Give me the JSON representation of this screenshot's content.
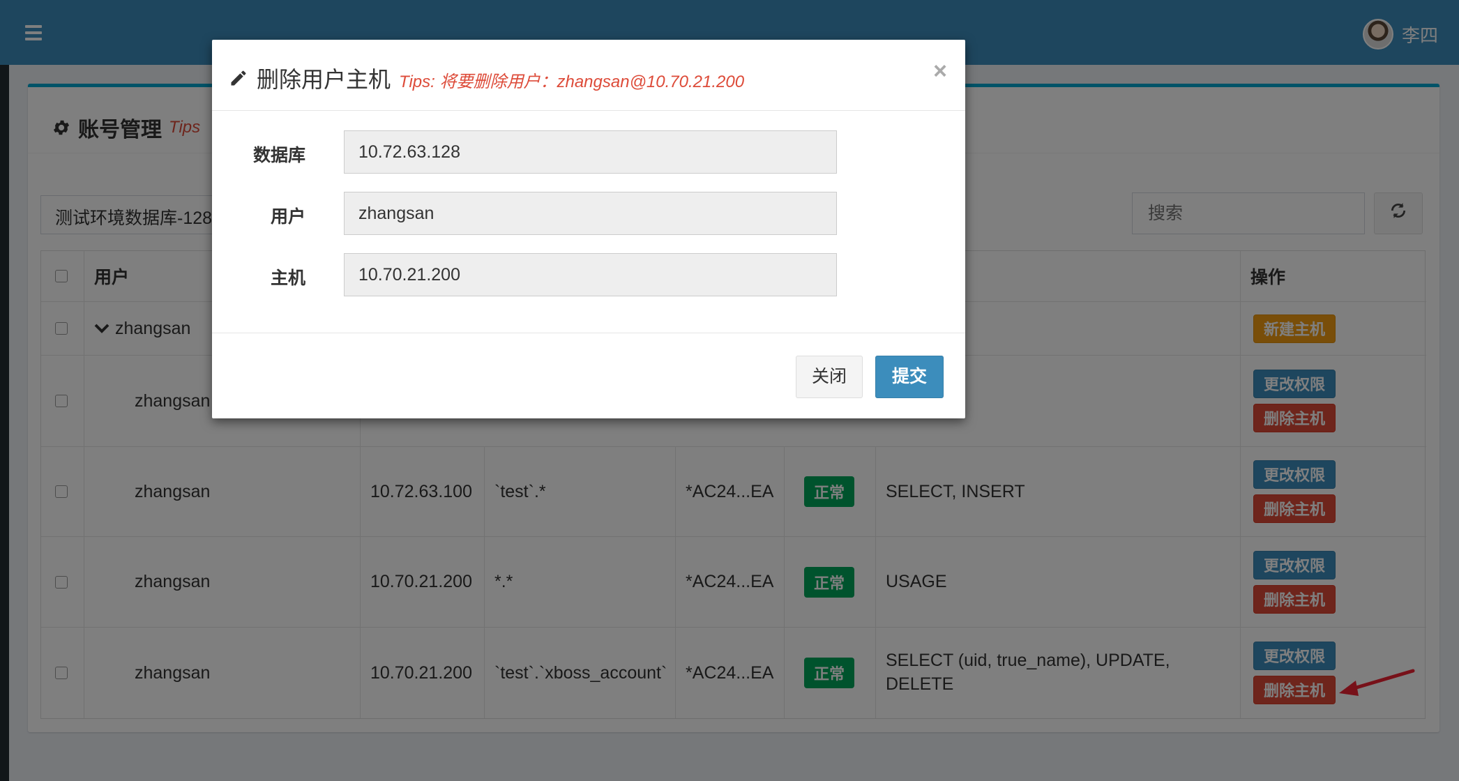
{
  "navbar": {
    "toggle_icon": "hamburger-icon",
    "user_name": "李四"
  },
  "box": {
    "title": "账号管理",
    "tips": "Tips",
    "db_selected": "测试环境数据库-128",
    "search_placeholder": "搜索",
    "refresh_icon": "refresh-icon"
  },
  "table": {
    "headers": {
      "user": "用户",
      "actions": "操作"
    },
    "group_user": "zhangsan",
    "rows": [
      {
        "user": "zhangsan",
        "host": "",
        "db": "",
        "password": "",
        "status": "",
        "privs": "",
        "btn1": "更改权限",
        "btn2": "删除主机"
      },
      {
        "user": "zhangsan",
        "host": "10.72.63.100",
        "db": "`test`.*",
        "password": "*AC24...EA",
        "status": "正常",
        "privs": "SELECT, INSERT",
        "btn1": "更改权限",
        "btn2": "删除主机"
      },
      {
        "user": "zhangsan",
        "host": "10.70.21.200",
        "db": "*.*",
        "password": "*AC24...EA",
        "status": "正常",
        "privs": "USAGE",
        "btn1": "更改权限",
        "btn2": "删除主机"
      },
      {
        "user": "zhangsan",
        "host": "10.70.21.200",
        "db": "`test`.`xboss_account`",
        "password": "*AC24...EA",
        "status": "正常",
        "privs": "SELECT (uid, true_name), UPDATE, DELETE",
        "btn1": "更改权限",
        "btn2": "删除主机"
      }
    ],
    "new_host_btn": "新建主机"
  },
  "modal": {
    "title": "删除用户主机",
    "tips": "Tips: 将要删除用户：zhangsan@10.70.21.200",
    "fields": [
      {
        "label": "数据库",
        "value": "10.72.63.128"
      },
      {
        "label": "用户",
        "value": "zhangsan"
      },
      {
        "label": "主机",
        "value": "10.70.21.200"
      }
    ],
    "close_label": "关闭",
    "submit_label": "提交"
  }
}
